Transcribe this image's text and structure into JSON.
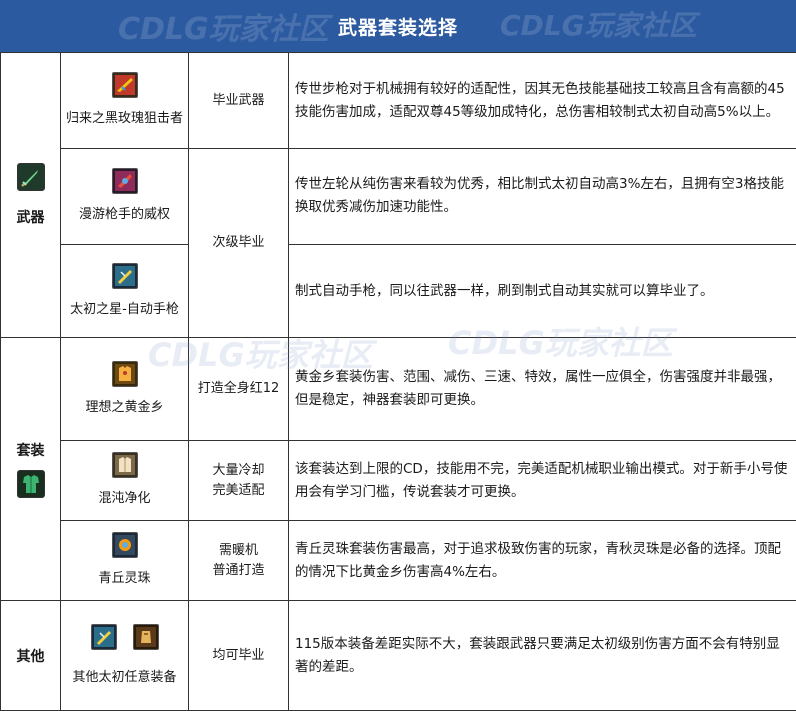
{
  "header": {
    "title": "武器套装选择"
  },
  "colors": {
    "header_bg": "#2c5aa0",
    "weapon_icon": "#1f5a2c",
    "armor_icon": "#2e8b57",
    "border": "#333333"
  },
  "watermark": {
    "text": "CDLG玩家社区"
  },
  "sections": {
    "weapon": {
      "label": "武器",
      "icon": "sword-icon",
      "rows": [
        {
          "name": "归来之黑玫瑰狙击者",
          "icon": "rifle-icon",
          "tier": "毕业武器",
          "desc": "传世步枪对于机械拥有较好的适配性，因其无色技能基础技工较高且含有高额的45技能伤害加成，适配双尊45等级加成特化，总伤害相较制式太初自动高5%以上。"
        },
        {
          "name": "漫游枪手的威权",
          "icon": "revolver-icon",
          "tier": "次级毕业",
          "desc": "传世左轮从纯伤害来看较为优秀，相比制式太初自动高3%左右，且拥有空3格技能换取优秀减伤加速功能性。"
        },
        {
          "name": "太初之星-自动手枪",
          "icon": "auto-pistol-icon",
          "desc": "制式自动手枪，同以往武器一样，刷到制式自动其实就可以算毕业了。"
        }
      ]
    },
    "set": {
      "label": "套装",
      "icon": "armor-icon",
      "rows": [
        {
          "name": "理想之黄金乡",
          "icon": "gold-armor-icon",
          "tier": "打造全身红12",
          "desc": "黄金乡套装伤害、范围、减伤、三速、特效，属性一应俱全，伤害强度并非最强，但是稳定，神器套装即可更换。"
        },
        {
          "name": "混沌净化",
          "icon": "chaos-armor-icon",
          "tier_line1": "大量冷却",
          "tier_line2": "完美适配",
          "desc": "该套装达到上限的CD，技能用不完，完美适配机械职业输出模式。对于新手小号使用会有学习门槛，传说套装才可更换。"
        },
        {
          "name": "青丘灵珠",
          "icon": "orb-armor-icon",
          "tier_line1": "需暖机",
          "tier_line2": "普通打造",
          "desc": "青丘灵珠套装伤害最高，对于追求极致伤害的玩家，青秋灵珠是必备的选择。顶配的情况下比黄金乡伤害高4%左右。"
        }
      ]
    },
    "other": {
      "label": "其他",
      "rows": [
        {
          "name": "其他太初任意装备",
          "icons": [
            "taichu-weapon-icon",
            "taichu-armor-icon"
          ],
          "tier": "均可毕业",
          "desc": "115版本装备差距实际不大，套装跟武器只要满足太初级别伤害方面不会有特别显著的差距。"
        }
      ]
    }
  }
}
